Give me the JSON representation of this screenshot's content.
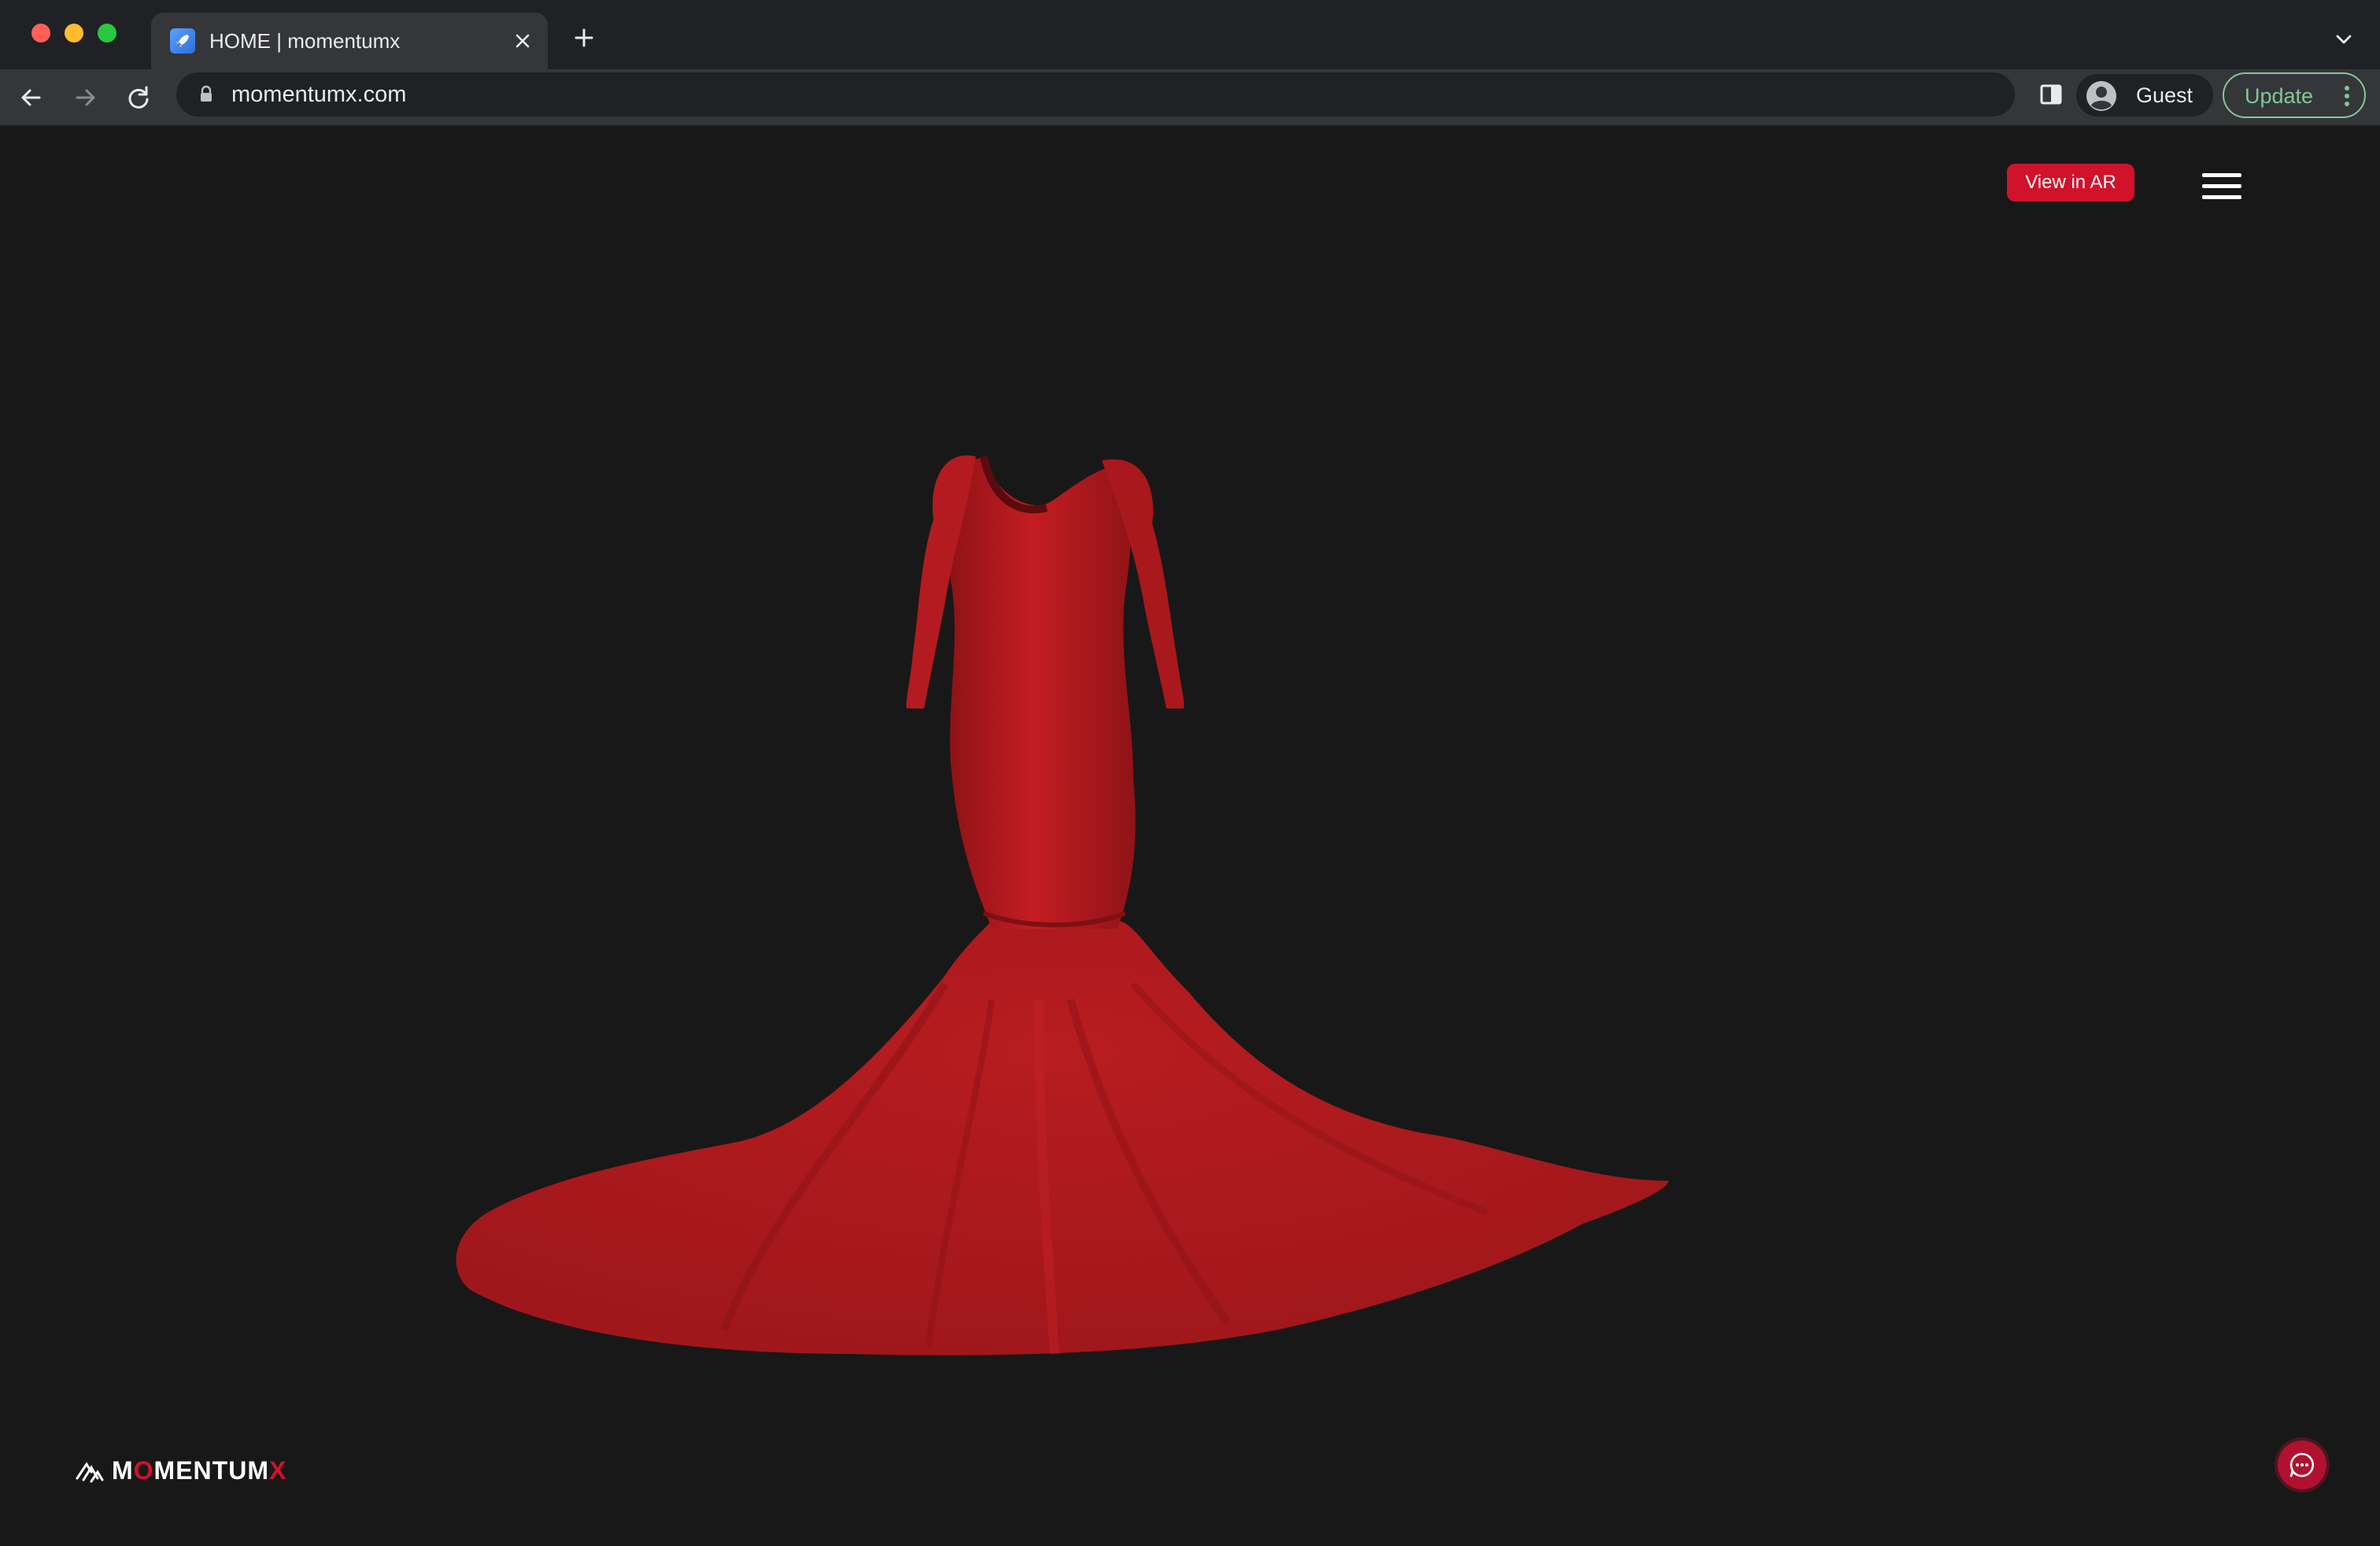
{
  "browser": {
    "tab": {
      "title": "HOME | momentumx"
    },
    "address_bar": {
      "url": "momentumx.com"
    },
    "profile": {
      "label": "Guest"
    },
    "update": {
      "label": "Update"
    }
  },
  "page": {
    "ar_button": {
      "label": "View in AR"
    },
    "logo": {
      "text_before": "M",
      "text_accent_o": "O",
      "text_middle": "MENTUM",
      "text_accent_x": "X"
    },
    "accent_color": "#d0122b",
    "product": {
      "name": "red-mermaid-gown-3d-model"
    }
  },
  "icons": {
    "back": "arrow-left-icon",
    "forward": "arrow-right-icon",
    "reload": "reload-icon",
    "lock": "lock-icon",
    "side_panel": "side-panel-icon",
    "menu": "hamburger-menu-icon",
    "chat": "chat-bubble-icon"
  }
}
